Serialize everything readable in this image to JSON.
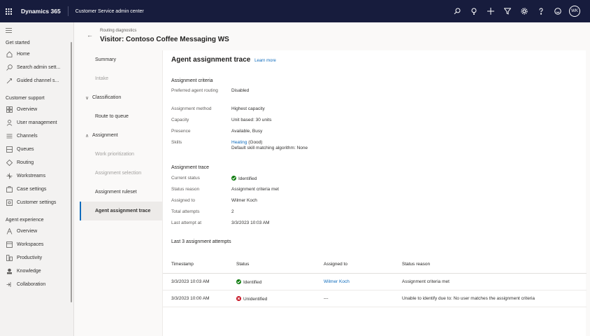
{
  "topbar": {
    "brand": "Dynamics 365",
    "app_name": "Customer Service admin center",
    "avatar_initials": "WK",
    "icons": [
      "search-icon",
      "lightbulb-icon",
      "plus-icon",
      "filter-icon",
      "gear-icon",
      "help-icon",
      "smiley-icon"
    ]
  },
  "nav": {
    "groups": [
      {
        "title": "Get started",
        "items": [
          {
            "label": "Home",
            "icon": "home-icon"
          },
          {
            "label": "Search admin sett...",
            "icon": "search-icon"
          },
          {
            "label": "Guided channel s...",
            "icon": "rocket-icon"
          }
        ]
      },
      {
        "title": "Customer support",
        "items": [
          {
            "label": "Overview",
            "icon": "overview-icon"
          },
          {
            "label": "User management",
            "icon": "user-management-icon"
          },
          {
            "label": "Channels",
            "icon": "channels-icon"
          },
          {
            "label": "Queues",
            "icon": "queues-icon"
          },
          {
            "label": "Routing",
            "icon": "routing-icon"
          },
          {
            "label": "Workstreams",
            "icon": "workstreams-icon"
          },
          {
            "label": "Case settings",
            "icon": "case-settings-icon"
          },
          {
            "label": "Customer settings",
            "icon": "customer-settings-icon"
          }
        ]
      },
      {
        "title": "Agent experience",
        "items": [
          {
            "label": "Overview",
            "icon": "overview-icon"
          },
          {
            "label": "Workspaces",
            "icon": "workspaces-icon"
          },
          {
            "label": "Productivity",
            "icon": "productivity-icon"
          },
          {
            "label": "Knowledge",
            "icon": "knowledge-icon"
          },
          {
            "label": "Collaboration",
            "icon": "collaboration-icon"
          }
        ]
      }
    ]
  },
  "header": {
    "breadcrumb": "Routing diagnostics",
    "title": "Visitor: Contoso Coffee Messaging WS"
  },
  "steps": {
    "summary": "Summary",
    "intake": "Intake",
    "classification": "Classification",
    "route_to_queue": "Route to queue",
    "assignment": "Assignment",
    "work_prioritization": "Work prioritization",
    "assignment_selection": "Assignment selection",
    "assignment_ruleset": "Assignment ruleset",
    "agent_assignment_trace": "Agent assignment trace"
  },
  "trace": {
    "title": "Agent assignment trace",
    "learn_more": "Learn more",
    "criteria": {
      "title": "Assignment criteria",
      "preferred_agent_label": "Preferred agent routing",
      "preferred_agent_value": "Disabled",
      "method_label": "Assignment method",
      "method_value": "Highest capacity",
      "capacity_label": "Capacity",
      "capacity_value": "Unit based: 30 units",
      "presence_label": "Presence",
      "presence_value": "Available, Busy",
      "skills_label": "Skills",
      "skills_link": "Heating",
      "skills_rating": "(Good)",
      "skills_algorithm": "Default skill matching algorithm: None"
    },
    "assignment": {
      "title": "Assignment trace",
      "current_status_label": "Current status",
      "current_status_value": "Identified",
      "status_reason_label": "Status reason",
      "status_reason_value": "Assignment criteria met",
      "assigned_to_label": "Assigned to",
      "assigned_to_value": "Wilmer Koch",
      "total_attempts_label": "Total attempts",
      "total_attempts_value": "2",
      "last_attempt_label": "Last attempt at",
      "last_attempt_value": "3/3/2023 10:03 AM"
    },
    "attempts": {
      "title": "Last 3 assignment attempts",
      "headers": [
        "Timestamp",
        "Status",
        "Assigned to",
        "Status reason"
      ],
      "rows": [
        {
          "timestamp": "3/3/2023 10:03 AM",
          "status": "Identified",
          "assigned_to": "Wilmer Koch",
          "reason": "Assignment criteria met"
        },
        {
          "timestamp": "3/3/2023 10:00 AM",
          "status": "Unidentified",
          "assigned_to": "---",
          "reason": "Unable to identify due to: No user matches the assignment criteria"
        }
      ]
    }
  },
  "colors": {
    "topbar": "#171c3d",
    "accent": "#0f6cbd",
    "success": "#107c10",
    "error": "#c50f1f"
  }
}
